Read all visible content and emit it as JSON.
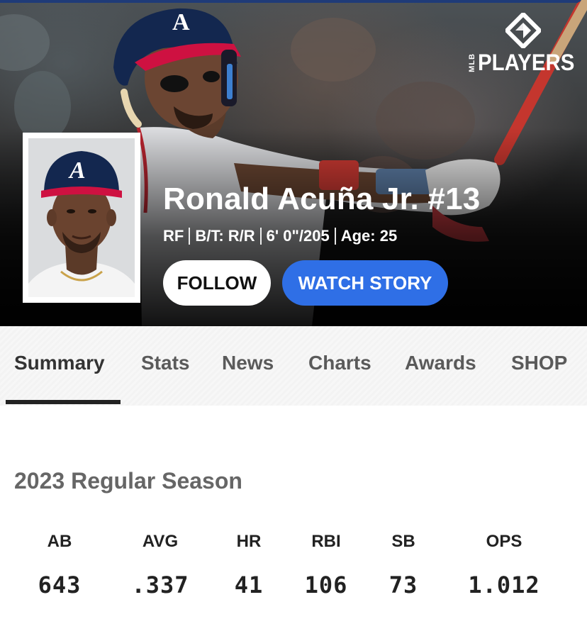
{
  "brand": {
    "logo_prefix": "MLB",
    "logo_text": "PLAYERS"
  },
  "player": {
    "name": "Ronald Acuña Jr. #13",
    "position": "RF",
    "bats_throws": "B/T: R/R",
    "height_weight": "6' 0\"/205",
    "age": "Age: 25"
  },
  "actions": {
    "follow_label": "FOLLOW",
    "watch_story_label": "WATCH STORY"
  },
  "tabs": [
    {
      "label": "Summary",
      "active": true
    },
    {
      "label": "Stats",
      "active": false
    },
    {
      "label": "News",
      "active": false
    },
    {
      "label": "Charts",
      "active": false
    },
    {
      "label": "Awards",
      "active": false
    },
    {
      "label": "SHOP",
      "active": false
    }
  ],
  "season": {
    "title": "2023 Regular Season",
    "stats": [
      {
        "label": "AB",
        "value": "643"
      },
      {
        "label": "AVG",
        "value": ".337"
      },
      {
        "label": "HR",
        "value": "41"
      },
      {
        "label": "RBI",
        "value": "106"
      },
      {
        "label": "SB",
        "value": "73"
      },
      {
        "label": "OPS",
        "value": "1.012"
      }
    ]
  },
  "colors": {
    "accent_blue": "#2f6fe6",
    "team_navy": "#13274f",
    "team_red": "#ce1141"
  }
}
